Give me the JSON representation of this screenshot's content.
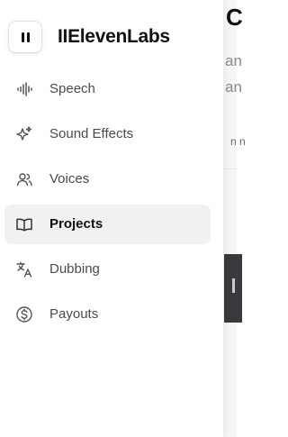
{
  "app": {
    "brand": "IIElevenLabs"
  },
  "sidebar": {
    "items": [
      {
        "label": "Speech",
        "icon": "waveform-icon",
        "active": false
      },
      {
        "label": "Sound Effects",
        "icon": "sparkles-icon",
        "active": false
      },
      {
        "label": "Voices",
        "icon": "users-icon",
        "active": false
      },
      {
        "label": "Projects",
        "icon": "book-open-icon",
        "active": true
      },
      {
        "label": "Dubbing",
        "icon": "translate-icon",
        "active": false
      },
      {
        "label": "Payouts",
        "icon": "dollar-circle-icon",
        "active": false
      }
    ]
  },
  "background": {
    "title": "C",
    "lines": [
      "an",
      "an"
    ],
    "tab": "n n"
  }
}
